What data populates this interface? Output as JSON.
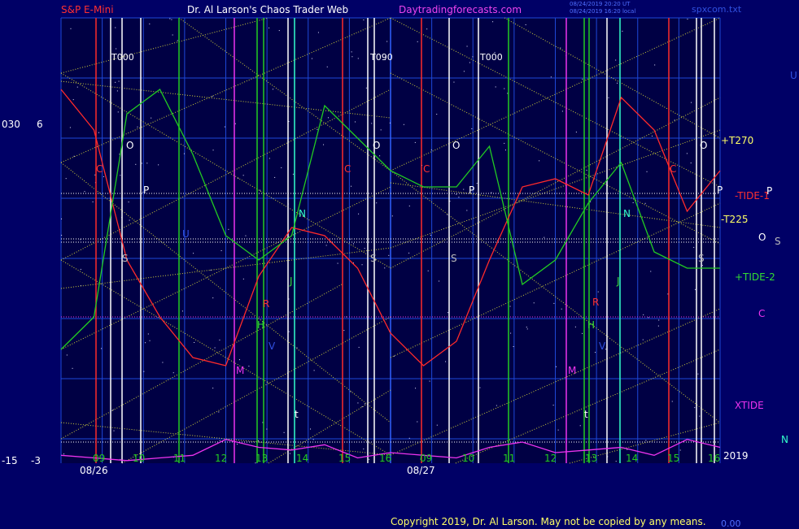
{
  "header": {
    "symbol": "S&P E-Mini",
    "brand": "Dr. Al Larson's Chaos Trader Web",
    "site": "Daytradingforecasts.com",
    "stamp_line1": "08/24/2019 20:20 UT",
    "stamp_line2": "08/24/2019 16:20 local",
    "file": "spxcom.txt"
  },
  "left_axis": {
    "top_a": "030",
    "top_b": "6",
    "bot_a": "-15",
    "bot_b": "-3"
  },
  "dates": {
    "day1": "08/26",
    "day2": "08/27"
  },
  "right_labels": {
    "u": "U",
    "t270": "+T270",
    "tide1": "-TIDE-1",
    "p": "P",
    "t225": "-T225",
    "o": "O",
    "s": "S",
    "tide2": "+TIDE-2",
    "c": "C",
    "xtide": "XTIDE",
    "n": "N",
    "year": "2019"
  },
  "footer": {
    "copyright": "Copyright 2019, Dr. Al Larson. May not be copied by any means.",
    "tail": "0.00"
  },
  "colors": {
    "background": "#000066",
    "plot_bg": "#000044",
    "grid": "#1e48d8",
    "ephem_yellow": "#cfcf3a",
    "red_line": "#ff2a2a",
    "green_line": "#22cc22",
    "magenta_line": "#ee33ee",
    "white_line": "#ffffff",
    "cyan_line": "#33ffcc"
  },
  "chart_data": {
    "type": "line",
    "x_axis": "time (hours)",
    "days": [
      {
        "date": "08/26",
        "hours": [
          "09",
          "10",
          "11",
          "12",
          "13",
          "14",
          "15",
          "16"
        ]
      },
      {
        "date": "08/27",
        "hours": [
          "09",
          "10",
          "11",
          "12",
          "13",
          "14",
          "15",
          "16"
        ]
      }
    ],
    "vertical_markers": [
      {
        "label": "T000",
        "day": 1,
        "hour": 9.8
      },
      {
        "label": "T090",
        "day": 1,
        "hour": 16.0
      },
      {
        "label": "T000",
        "day": 2,
        "hour": 10.5
      }
    ],
    "series": [
      {
        "name": "-TIDE-1",
        "color": "red",
        "x": [
          0,
          0.05,
          0.1,
          0.15,
          0.2,
          0.25,
          0.3,
          0.35,
          0.4,
          0.45,
          0.5,
          0.55,
          0.6,
          0.65,
          0.7,
          0.75,
          0.8,
          0.85,
          0.9,
          0.95,
          1.0
        ],
        "y": [
          0.85,
          0.6,
          -0.2,
          -0.55,
          -0.8,
          -0.85,
          -0.3,
          0.0,
          -0.05,
          -0.25,
          -0.65,
          -0.85,
          -0.7,
          -0.2,
          0.25,
          0.3,
          0.2,
          0.8,
          0.6,
          0.1,
          0.35
        ]
      },
      {
        "name": "+TIDE-2",
        "color": "green",
        "x": [
          0,
          0.05,
          0.1,
          0.15,
          0.2,
          0.25,
          0.3,
          0.35,
          0.4,
          0.45,
          0.5,
          0.55,
          0.6,
          0.65,
          0.7,
          0.75,
          0.8,
          0.85,
          0.9,
          0.95,
          1.0
        ],
        "y": [
          -0.7,
          -0.5,
          0.75,
          0.9,
          0.5,
          0.0,
          -0.15,
          0.0,
          0.8,
          0.6,
          0.4,
          0.3,
          0.3,
          0.55,
          -0.3,
          -0.15,
          0.2,
          0.45,
          -0.1,
          -0.2,
          -0.2
        ]
      },
      {
        "name": "XTIDE",
        "color": "magenta",
        "x": [
          0,
          0.05,
          0.1,
          0.15,
          0.2,
          0.25,
          0.3,
          0.35,
          0.4,
          0.45,
          0.5,
          0.55,
          0.6,
          0.65,
          0.7,
          0.75,
          0.8,
          0.85,
          0.9,
          0.95,
          1.0
        ],
        "y": [
          -0.85,
          -0.9,
          -0.95,
          -0.9,
          -0.85,
          -0.55,
          -0.7,
          -0.75,
          -0.65,
          -0.9,
          -0.8,
          -0.85,
          -0.9,
          -0.7,
          -0.6,
          -0.8,
          -0.75,
          -0.7,
          -0.85,
          -0.55,
          -0.7
        ]
      }
    ],
    "event_letters": [
      "O",
      "P",
      "S",
      "C",
      "N",
      "J",
      "R",
      "H",
      "V",
      "M",
      "t",
      "U",
      "D"
    ]
  }
}
